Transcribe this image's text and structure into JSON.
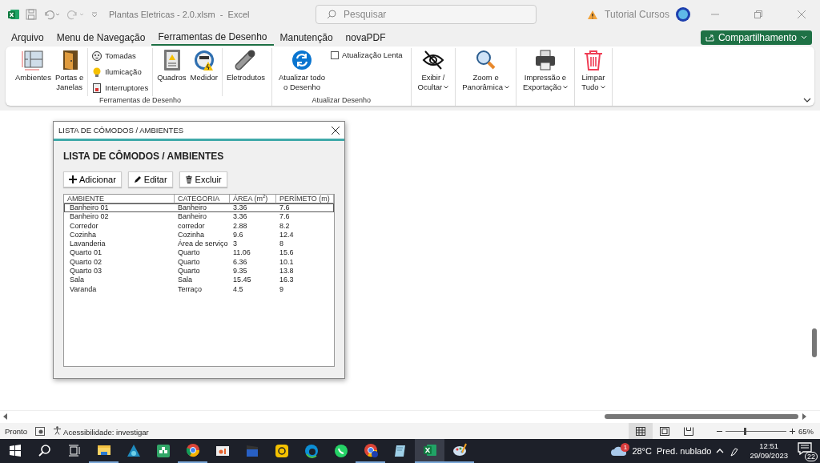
{
  "title_bar": {
    "title": "Plantas Eletricas - 2.0.xlsm  -  Excel",
    "search": {
      "placeholder": "Pesquisar"
    },
    "user": "Tutorial Cursos"
  },
  "menu_tabs": [
    {
      "label": "Arquivo",
      "selected": false
    },
    {
      "label": "Menu de Navegação",
      "selected": false
    },
    {
      "label": "Ferramentas de Desenho",
      "selected": true
    },
    {
      "label": "Manutenção",
      "selected": false
    },
    {
      "label": "novaPDF",
      "selected": false
    }
  ],
  "share_button": "Compartilhamento",
  "ribbon": {
    "groups": [
      {
        "label": "Ferramentas de Desenho",
        "sections": [
          [
            {
              "kind": "large",
              "label": "Ambientes"
            },
            {
              "kind": "large",
              "label": "Portas e\nJanelas"
            }
          ],
          [
            {
              "kind": "small",
              "label": "Tomadas"
            },
            {
              "kind": "small",
              "label": "Ilumicação"
            },
            {
              "kind": "small",
              "label": "Interruptores"
            }
          ],
          [
            {
              "kind": "large",
              "label": "Quadros"
            },
            {
              "kind": "large",
              "label": "Medidor"
            }
          ],
          [
            {
              "kind": "large",
              "label": "Eletrodutos"
            }
          ]
        ]
      },
      {
        "label": "Atualizar Desenho",
        "sections": [
          [
            {
              "kind": "large",
              "label": "Atualizar todo\no Desenho"
            },
            {
              "kind": "checkbox",
              "label": "Atualização Lenta",
              "checked": false
            }
          ]
        ]
      },
      {
        "sections": [
          [
            {
              "kind": "large",
              "label": "Exibir /\nOcultar",
              "dropdown": true
            }
          ]
        ]
      },
      {
        "sections": [
          [
            {
              "kind": "large",
              "label": "Zoom e\nPanorâmica",
              "dropdown": true
            }
          ]
        ]
      },
      {
        "sections": [
          [
            {
              "kind": "large",
              "label": "Impressão e\nExportação",
              "dropdown": true
            }
          ]
        ]
      },
      {
        "sections": [
          [
            {
              "kind": "large",
              "label": "Limpar\nTudo",
              "dropdown": true
            }
          ]
        ]
      }
    ]
  },
  "dialog": {
    "title": "LISTA DE CÔMODOS / AMBIENTES",
    "heading": "LISTA DE CÔMODOS / AMBIENTES",
    "buttons": [
      "Adicionar",
      "Editar",
      "Excluir"
    ],
    "columns": [
      "AMBIENTE",
      "CATEGORIA",
      "ÁREA (m$^{2}$)",
      "PERÍMETO (m)"
    ],
    "rows": [
      {
        "cells": [
          "Banheiro 01",
          "Banheiro",
          "3.36",
          "7.6"
        ],
        "selected": true
      },
      {
        "cells": [
          "Banheiro 02",
          "Banheiro",
          "3.36",
          "7.6"
        ],
        "selected": false
      },
      {
        "cells": [
          "Corredor",
          "corredor",
          "2.88",
          "8.2"
        ],
        "selected": false
      },
      {
        "cells": [
          "Cozinha",
          "Cozinha",
          "9.6",
          "12.4"
        ],
        "selected": false
      },
      {
        "cells": [
          "Lavanderia",
          "Área de serviço",
          "3",
          "8"
        ],
        "selected": false
      },
      {
        "cells": [
          "Quarto 01",
          "Quarto",
          "11.06",
          "15.6"
        ],
        "selected": false
      },
      {
        "cells": [
          "Quarto 02",
          "Quarto",
          "6.36",
          "10.1"
        ],
        "selected": false
      },
      {
        "cells": [
          "Quarto 03",
          "Quarto",
          "9.35",
          "13.8"
        ],
        "selected": false
      },
      {
        "cells": [
          "Sala",
          "Sala",
          "15.45",
          "16.3"
        ],
        "selected": false
      },
      {
        "cells": [
          "Varanda",
          "Terraço",
          "4.5",
          "9"
        ],
        "selected": false
      }
    ]
  },
  "status_bar": {
    "status": "Pronto",
    "accessibility": "Acessibilidade: investigar",
    "views": [
      {
        "selected": true
      },
      {
        "selected": false
      },
      {
        "selected": false
      }
    ],
    "zoom": {
      "level": 0.32,
      "reading": "65%"
    }
  },
  "taskbar": {
    "apps": [
      {
        "running": true,
        "selected": false
      },
      {
        "running": false,
        "selected": false
      },
      {
        "running": false,
        "selected": false
      },
      {
        "running": true,
        "selected": false
      },
      {
        "running": false,
        "selected": false
      },
      {
        "running": false,
        "selected": false
      },
      {
        "running": false,
        "selected": false
      },
      {
        "running": false,
        "selected": false
      },
      {
        "running": false,
        "selected": false
      },
      {
        "running": true,
        "selected": false
      },
      {
        "running": false,
        "selected": false
      },
      {
        "running": true,
        "selected": true
      },
      {
        "running": true,
        "selected": false
      }
    ],
    "weather": {
      "badge": "1",
      "temperature": "28°C",
      "condition": "Pred. nublado"
    },
    "clock": {
      "time": "12:51",
      "date": "29/09/2023"
    },
    "notifications": "22"
  }
}
